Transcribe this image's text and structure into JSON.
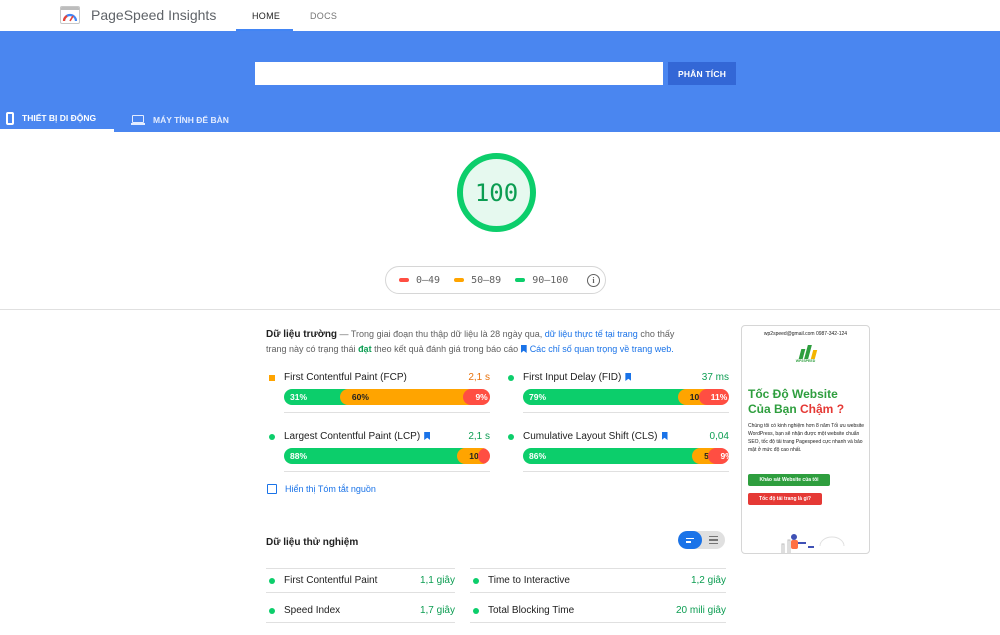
{
  "header": {
    "brand": "PageSpeed Insights",
    "nav": {
      "home": "HOME",
      "docs": "DOCS"
    }
  },
  "search": {
    "value": "",
    "placeholder": "",
    "button_label": "PHÂN TÍCH"
  },
  "device_tabs": {
    "mobile": "THIẾT BỊ DI ĐỘNG",
    "desktop": "MÁY TÍNH ĐỂ BÀN",
    "active": "mobile"
  },
  "score": {
    "value": "100",
    "color": "#0cce6b"
  },
  "legend": [
    {
      "range": "0–49",
      "color": "#ff4e42"
    },
    {
      "range": "50–89",
      "color": "#ffa400"
    },
    {
      "range": "90–100",
      "color": "#0cce6b"
    }
  ],
  "field_data": {
    "title": "Dữ liệu trường",
    "intro_1": " — Trong giai đoạn thu thập dữ liệu là 28 ngày qua, ",
    "link_1": "dữ liệu thực tế tại trang",
    "intro_2": " cho thấy trang này có trạng thái ",
    "status": "đạt",
    "intro_3": " theo kết quả đánh giá trong báo cáo ",
    "link_2": "Các chỉ số quan trọng về trang web.",
    "metrics": [
      {
        "label": "First Contentful Paint (FCP)",
        "value": "2,1 s",
        "value_color": "#e8710a",
        "indicator": "square",
        "bookmark": false,
        "dist": [
          {
            "label": "31%",
            "pct": 31,
            "kind": "g"
          },
          {
            "label": "60%",
            "pct": 60,
            "kind": "o"
          },
          {
            "label": "9%",
            "pct": 9,
            "kind": "r"
          }
        ]
      },
      {
        "label": "First Input Delay (FID)",
        "value": "37 ms",
        "value_color": "#0c9d52",
        "indicator": "circle",
        "bookmark": true,
        "dist": [
          {
            "label": "79%",
            "pct": 79,
            "kind": "g"
          },
          {
            "label": "10%",
            "pct": 10,
            "kind": "o"
          },
          {
            "label": "11%",
            "pct": 11,
            "kind": "r"
          }
        ]
      },
      {
        "label": "Largest Contentful Paint (LCP)",
        "value": "2,1 s",
        "value_color": "#0c9d52",
        "indicator": "circle",
        "bookmark": true,
        "dist": [
          {
            "label": "88%",
            "pct": 88,
            "kind": "g"
          },
          {
            "label": "10%",
            "pct": 10,
            "kind": "o"
          },
          {
            "label": "3%",
            "pct": 3,
            "kind": "r"
          }
        ]
      },
      {
        "label": "Cumulative Layout Shift (CLS)",
        "value": "0,04",
        "value_color": "#0c9d52",
        "indicator": "circle",
        "bookmark": true,
        "dist": [
          {
            "label": "86%",
            "pct": 86,
            "kind": "g"
          },
          {
            "label": "5%",
            "pct": 5,
            "kind": "o"
          },
          {
            "label": "9%",
            "pct": 9,
            "kind": "r"
          }
        ]
      }
    ],
    "origin_summary": "Hiển thị Tóm tắt nguồn"
  },
  "lab_data": {
    "title": "Dữ liệu thử nghiệm",
    "metrics": [
      {
        "label": "First Contentful Paint",
        "value": "1,1 giây"
      },
      {
        "label": "Time to Interactive",
        "value": "1,2 giây"
      },
      {
        "label": "Speed Index",
        "value": "1,7 giây"
      },
      {
        "label": "Total Blocking Time",
        "value": "20 mili giây"
      }
    ]
  },
  "ad": {
    "contact": "wp2speed@gmail.com 0987-342-124",
    "logo_text": "WP2SPEED",
    "headline_1": "Tốc Độ Website",
    "headline_2": "Của Bạn ",
    "headline_3": "Chậm ?",
    "body": "Chúng tôi có kinh nghiệm hơn 8 năm Tối ưu website WordPress, bạn sẽ nhận được một website chuẩn SEO, tốc độ tải trang Pagespeed cực nhanh và bảo mật ở mức độ cao nhất.",
    "button_1": "Khảo sát Website của tôi",
    "button_2": "Tốc độ tải trang là gì?"
  }
}
